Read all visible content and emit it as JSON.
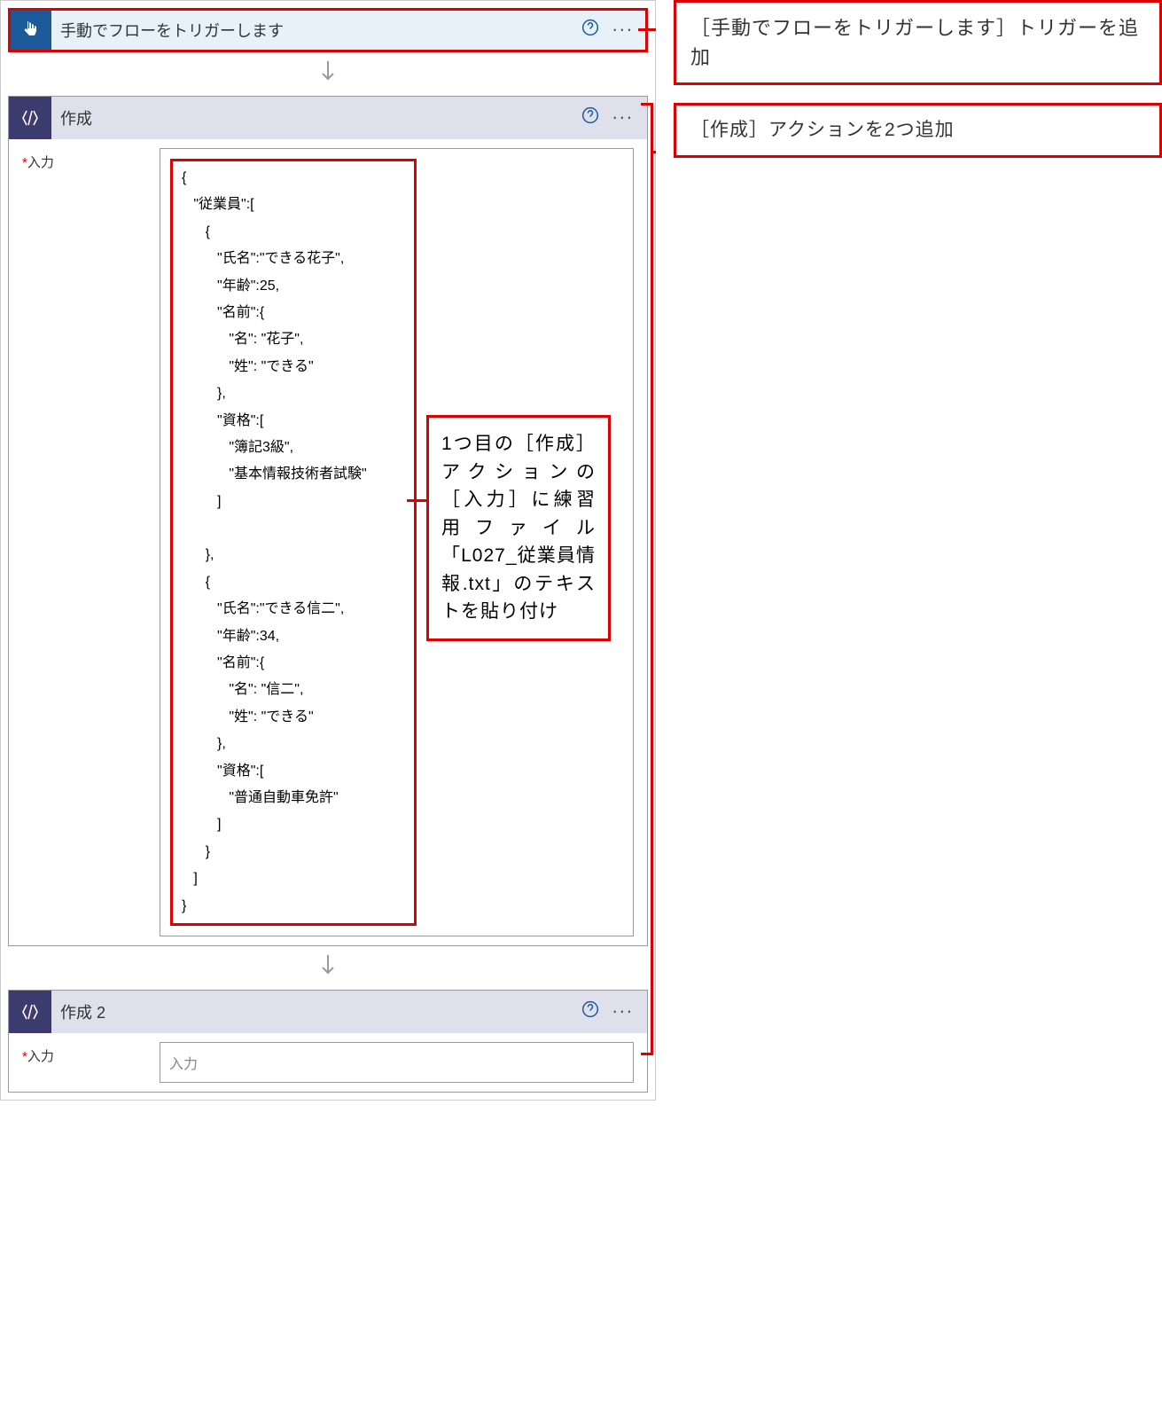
{
  "trigger": {
    "title": "手動でフローをトリガーします"
  },
  "compose1": {
    "title": "作成",
    "inputLabel": "入力",
    "jsonText": "{\n   \"従業員\":[\n      {\n         \"氏名\":\"できる花子\",\n         \"年齢\":25,\n         \"名前\":{\n            \"名\": \"花子\",\n            \"姓\": \"できる\"\n         },\n         \"資格\":[\n            \"簿記3級\",\n            \"基本情報技術者試験\"\n         ]\n\n      },\n      {\n         \"氏名\":\"できる信二\",\n         \"年齢\":34,\n         \"名前\":{\n            \"名\": \"信二\",\n            \"姓\": \"できる\"\n         },\n         \"資格\":[\n            \"普通自動車免許\"\n         ]\n      }\n   ]\n}"
  },
  "compose2": {
    "title": "作成 2",
    "inputLabel": "入力",
    "placeholder": "入力"
  },
  "annotations": {
    "a1": "［手動でフローをトリガーします］トリガーを追加",
    "a2": "［作成］アクションを2つ追加",
    "a3": "1つ目の［作成］アクションの［入力］に練習用ファイル「L027_従業員情報.txt」のテキストを貼り付け"
  },
  "symbols": {
    "required": "*",
    "help": "?",
    "more": "..."
  }
}
